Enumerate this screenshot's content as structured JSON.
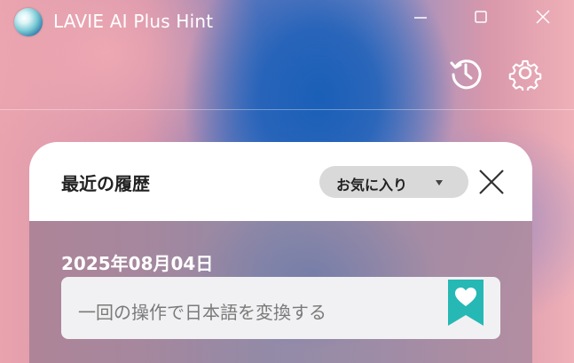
{
  "titlebar": {
    "app_title": "LAVIE AI Plus Hint"
  },
  "toolbar": {
    "history_icon": "history-clock-icon",
    "settings_icon": "gear-icon"
  },
  "panel": {
    "title": "最近の履歴",
    "filter": {
      "selected": "お気に入り"
    },
    "close_icon": "close-icon"
  },
  "history": {
    "groups": [
      {
        "date": "2025年08月04日",
        "items": [
          {
            "text": "一回の操作で日本語を変換する",
            "favorite": true
          }
        ]
      }
    ]
  },
  "colors": {
    "bookmark": "#26b8b4",
    "filter_bg": "#d9d9d9",
    "panel_header_bg": "#ffffff"
  }
}
